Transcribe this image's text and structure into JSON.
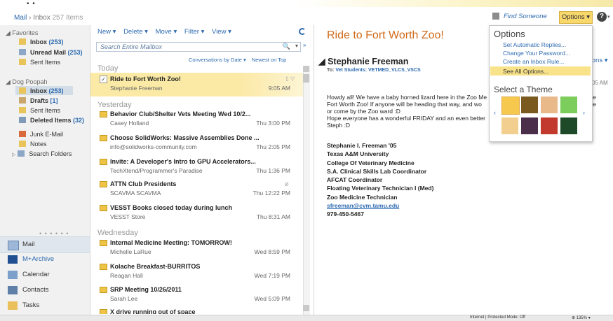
{
  "topbar": {
    "dots": "• •"
  },
  "header": {
    "mail": "Mail",
    "sep": "›",
    "inbox": "Inbox",
    "count": "257 Items",
    "find_someone": "Find Someone",
    "options_btn": "Options ▾",
    "help": "?"
  },
  "left": {
    "favorites_label": "◢ Favorites",
    "favorites": [
      {
        "label": "Inbox",
        "count": "(253)"
      },
      {
        "label": "Unread Mail",
        "count": "(253)"
      },
      {
        "label": "Sent Items",
        "count": ""
      }
    ],
    "account_label": "◢ Dog Poopah",
    "folders": [
      {
        "label": "Inbox",
        "count": "(253)"
      },
      {
        "label": "Drafts",
        "count": "[1]"
      },
      {
        "label": "Sent Items",
        "count": ""
      },
      {
        "label": "Deleted Items",
        "count": "(32)"
      },
      {
        "label": "Junk E-Mail",
        "count": ""
      },
      {
        "label": "Notes",
        "count": ""
      },
      {
        "label": "Search Folders",
        "count": ""
      }
    ],
    "search_folders_prefix": "▷",
    "nav_dots": "• • • • • •",
    "nav": [
      {
        "label": "Mail"
      },
      {
        "label": "M+Archive"
      },
      {
        "label": "Calendar"
      },
      {
        "label": "Contacts"
      },
      {
        "label": "Tasks"
      }
    ]
  },
  "middle": {
    "menu": [
      "New ▾",
      "Delete ▾",
      "Move ▾",
      "Filter ▾",
      "View ▾"
    ],
    "search_placeholder": "Search Entire Mailbox",
    "search_icon": "🔍",
    "search_dd": "▾",
    "search_expand": "»",
    "conv_by": "Conversations by Date ▾",
    "newest": "Newest on Top",
    "groups": {
      "today": "Today",
      "yesterday": "Yesterday",
      "wednesday": "Wednesday"
    },
    "messages": [
      {
        "subject": "Ride to Fort Worth Zoo!",
        "from": "Stephanie Freeman",
        "time": "9:05 AM",
        "attach": "",
        "flag": "▯ ▽"
      },
      {
        "subject": "Behavior Club/Shelter Vets Meeting Wed 10/2...",
        "from": "Casey Holland",
        "time": "Thu 3:00 PM",
        "attach": "",
        "flag": ""
      },
      {
        "subject": "Choose SolidWorks: Massive Assemblies Done ...",
        "from": "info@solidworks-community.com",
        "time": "Thu 2:05 PM",
        "attach": "",
        "flag": ""
      },
      {
        "subject": "Invite: A Developer's Intro to GPU Accelerators...",
        "from": "TechXtend/Programmer's Paradise",
        "time": "Thu 1:36 PM",
        "attach": "",
        "flag": ""
      },
      {
        "subject": "ATTN Club Presidents",
        "from": "SCAVMA SCAVMA",
        "time": "Thu 12:22 PM",
        "attach": "⊘",
        "flag": ""
      },
      {
        "subject": "VESST Books closed today during lunch",
        "from": "VESST Store",
        "time": "Thu 8:31 AM",
        "attach": "",
        "flag": ""
      },
      {
        "subject": "Internal Medicine Meeting: TOMORROW!",
        "from": "Michelle LaRue",
        "time": "Wed 8:59 PM",
        "attach": "",
        "flag": ""
      },
      {
        "subject": "Kolache Breakfast-BURRITOS",
        "from": "Reagan Hall",
        "time": "Wed 7:19 PM",
        "attach": "",
        "flag": ""
      },
      {
        "subject": "SRP Meeting 10/26/2011",
        "from": "Sarah Lee",
        "time": "Wed 5:09 PM",
        "attach": "",
        "flag": ""
      },
      {
        "subject": "X drive running out of space",
        "from": "",
        "time": "",
        "attach": "",
        "flag": ""
      }
    ]
  },
  "reading": {
    "title": "Ride to Fort Worth Zoo!",
    "from": "◢ Stephanie Freeman",
    "to_label": "To:",
    "to": "Vet Students: VETMED_VLCS_VSCS",
    "actions": "tions ▾",
    "time": "05 AM",
    "body": [
      "Howdy all! We have a baby horned lizard here in the Zoo Me",
      "Fort Worth Zoo! If anyone will be heading that way, and wo",
      "or come by the Zoo ward :D",
      "Hope everyone has a wonderful FRIDAY and an even better",
      "Steph :D"
    ],
    "body_tail": [
      "the",
      "me"
    ],
    "signature": [
      "Stephanie I. Freeman '05",
      "Texas A&M University",
      "College Of Veterinary Medicine",
      "S.A. Clinical Skills Lab Coordinator",
      "AFCAT Coordinator",
      "Floating Veterinary Technician I (Med)",
      "Zoo Medicine Technician"
    ],
    "email": "sfreeman@cvm.tamu.edu",
    "phone": "979-450-5467"
  },
  "options_menu": {
    "heading": "Options",
    "items": [
      "Set Automatic Replies...",
      "Change Your Password...",
      "Create an Inbox Rule...",
      "See All Options..."
    ],
    "theme_heading": "Select a Theme",
    "prev": "‹",
    "next": "›",
    "themes": [
      "#f6c94e",
      "#7a5a1e",
      "#e9b98a",
      "#7ccd5b",
      "#f2cf8e",
      "#4a2e4a",
      "#c23a2e",
      "#1f4a2a"
    ]
  },
  "status": {
    "zone": "Internet | Protected Mode: Off",
    "zoom": "⊕ 135% ▾"
  }
}
